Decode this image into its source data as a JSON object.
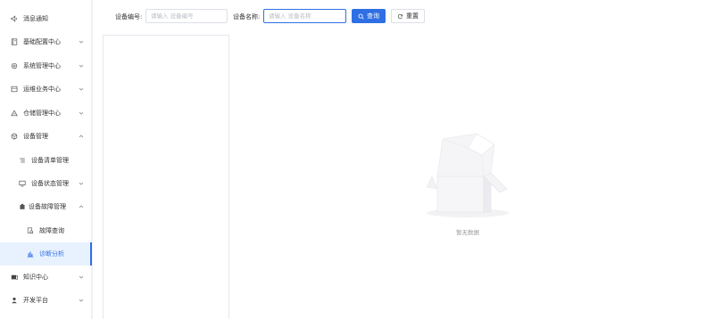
{
  "sidebar": {
    "items": [
      {
        "label": "消息通知",
        "icon": "speaker-icon",
        "chevron": ""
      },
      {
        "label": "基础配置中心",
        "icon": "book-icon",
        "chevron": "down"
      },
      {
        "label": "系统管理中心",
        "icon": "settings-icon",
        "chevron": "down"
      },
      {
        "label": "运维业务中心",
        "icon": "calendar-icon",
        "chevron": "down"
      },
      {
        "label": "仓储管理中心",
        "icon": "warehouse-icon",
        "chevron": "down"
      },
      {
        "label": "设备管理",
        "icon": "device-icon",
        "chevron": "up"
      },
      {
        "label": "设备清单管理",
        "icon": "list-icon",
        "chevron": ""
      },
      {
        "label": "设备状态管理",
        "icon": "monitor-icon",
        "chevron": "down"
      },
      {
        "label": "设备故障管理",
        "icon": "fault-icon",
        "chevron": "up"
      },
      {
        "label": "故障查询",
        "icon": "query-icon",
        "chevron": ""
      },
      {
        "label": "诊断分析",
        "icon": "bar-chart-icon",
        "chevron": ""
      },
      {
        "label": "知识中心",
        "icon": "knowledge-icon",
        "chevron": "down"
      },
      {
        "label": "开发平台",
        "icon": "developer-icon",
        "chevron": "down"
      }
    ],
    "active_index": 10,
    "accent": "#2f6fe4"
  },
  "search": {
    "device_code_label": "设备编号:",
    "device_code_placeholder": "请输入 设备编号",
    "device_code_value": "",
    "device_name_label": "设备名称:",
    "device_name_placeholder": "请输入 设备名称",
    "device_name_value": "",
    "query_label": "查询",
    "reset_label": "重置"
  },
  "content": {
    "empty_text": "暂无数据"
  }
}
